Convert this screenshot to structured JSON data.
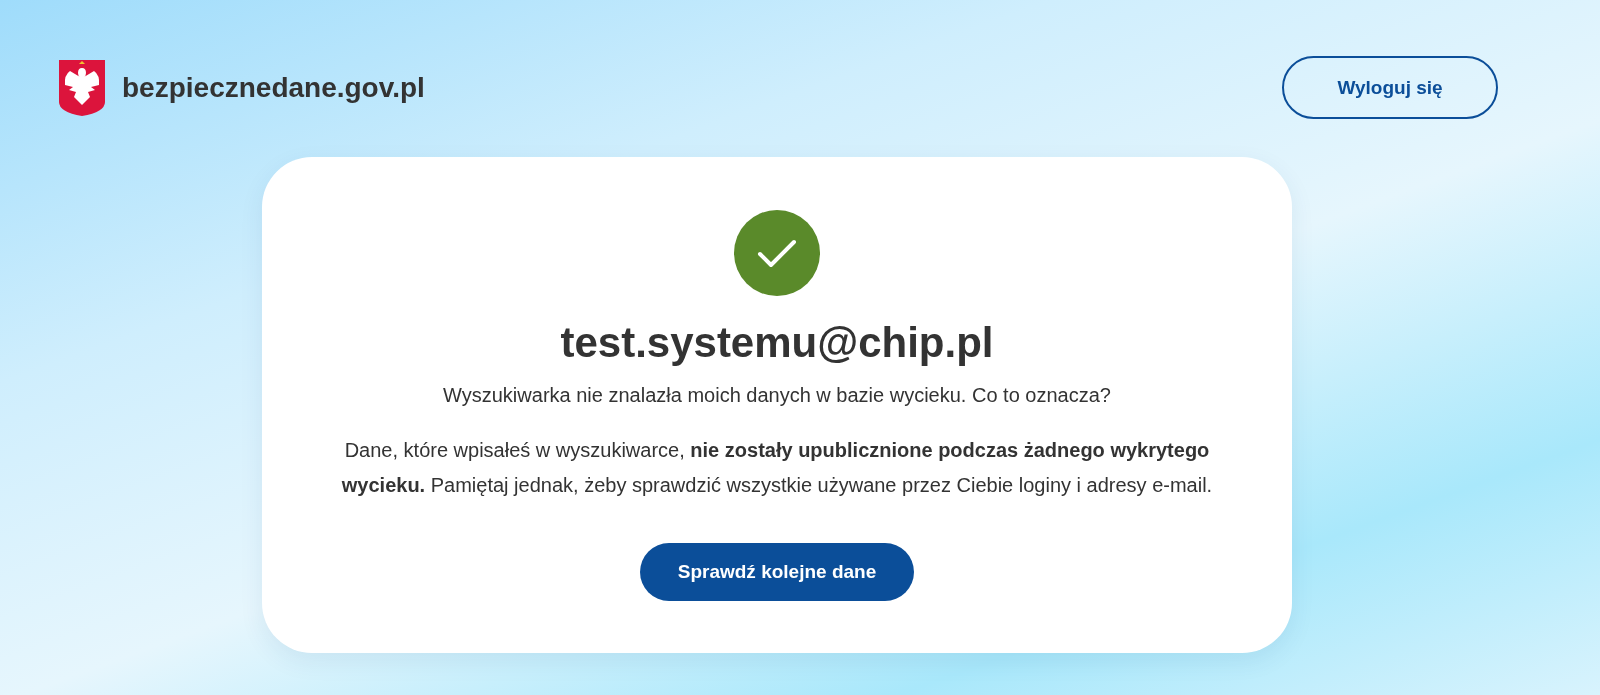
{
  "header": {
    "site_name": "bezpiecznedane.gov.pl",
    "logout_button": "Wyloguj się"
  },
  "result": {
    "kind": "success",
    "email": "test.systemu@chip.pl",
    "question": "Wyszukiwarka nie znalazła moich danych w bazie wycieku. Co to oznacza?",
    "explanation": "Dane, które wpisałeś w wyszukiwarce, **nie zostały upublicznione podczas żadnego wykrytego wycieku.** Pamiętaj jednak, żeby sprawdzić wszystkie używane przez Ciebie loginy i adresy e-mail.",
    "button": "Sprawdź kolejne dane"
  }
}
